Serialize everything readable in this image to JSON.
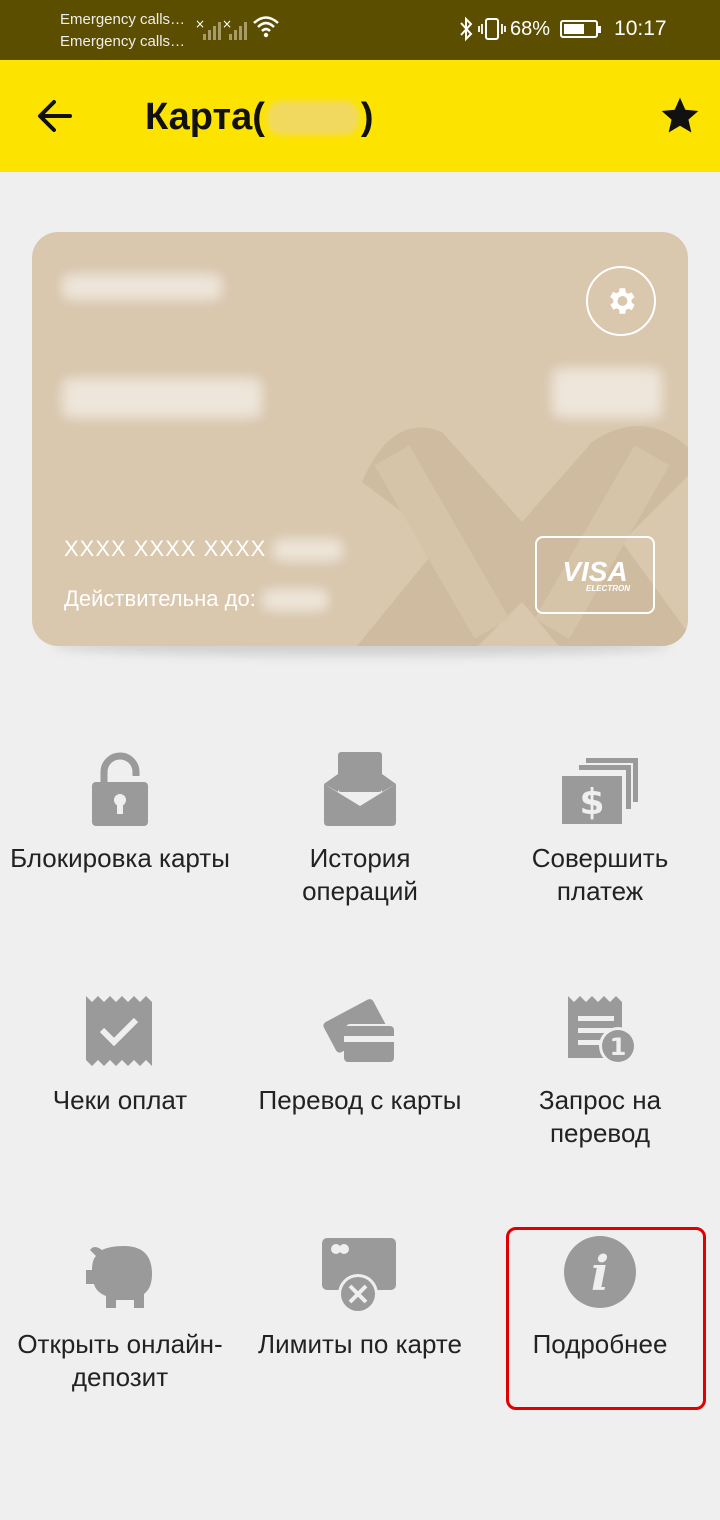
{
  "status_bar": {
    "line1": "Emergency calls…",
    "line2": "Emergency calls…",
    "battery": "68%",
    "battery_level": 0.68,
    "time": "10:17"
  },
  "header": {
    "title_prefix": "Карта(",
    "title_suffix": ")",
    "back_icon": "arrow-left-icon",
    "favorite_icon": "star-icon"
  },
  "card": {
    "number": "XXXX XXXX XXXX",
    "valid_label": "Действительна до:",
    "payment_brand": "VISA",
    "payment_brand_sub": "ELECTRON",
    "settings_icon": "gear-icon",
    "color": "#d9c7ae"
  },
  "actions": [
    {
      "label": "Блокировка карты",
      "icon": "lock-icon"
    },
    {
      "label": "История операций",
      "icon": "envelope-icon"
    },
    {
      "label": "Совершить платеж",
      "icon": "money-stack-icon"
    },
    {
      "label": "Чеки оплат",
      "icon": "receipt-check-icon"
    },
    {
      "label": "Перевод с карты",
      "icon": "cards-transfer-icon"
    },
    {
      "label": "Запрос на перевод",
      "icon": "request-receipt-icon"
    },
    {
      "label": "Открыть онлайн-депозит",
      "icon": "piggy-bank-icon"
    },
    {
      "label": "Лимиты по карте",
      "icon": "card-limit-icon"
    },
    {
      "label": "Подробнее",
      "icon": "info-icon"
    }
  ],
  "colors": {
    "header_bg": "#fde400",
    "status_bg": "#5c4e00",
    "icon_gray": "#9a9a9a",
    "highlight": "#e00000"
  }
}
